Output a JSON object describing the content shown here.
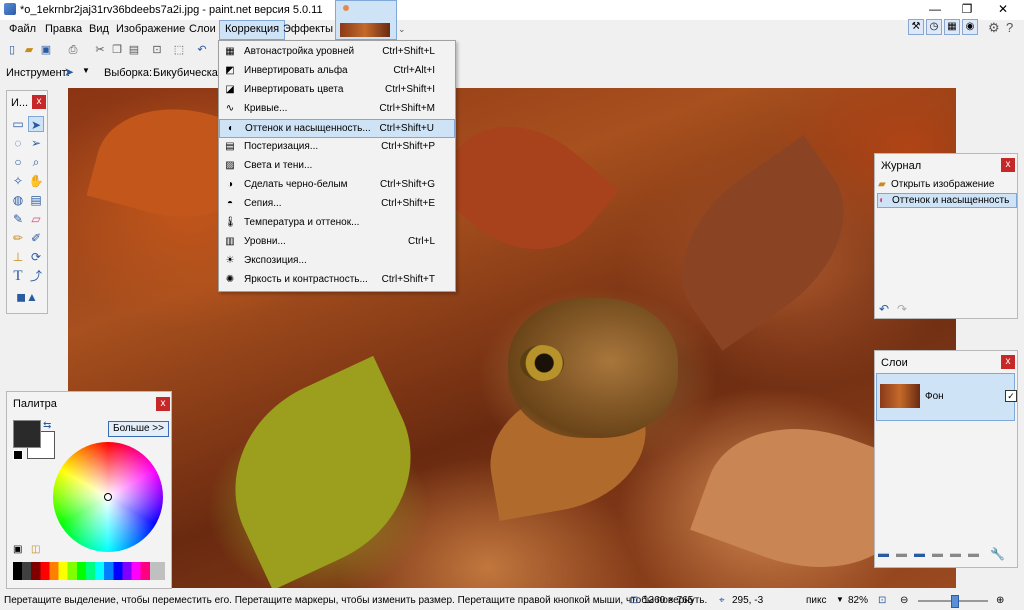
{
  "window": {
    "title": "*o_1ekrnbr2jaj31rv36bdeebs7a2i.jpg - paint.net версия 5.0.11",
    "minimize": "—",
    "maximize": "❐",
    "close": "✕"
  },
  "menubar": {
    "items": [
      "Файл",
      "Правка",
      "Вид",
      "Изображение",
      "Слои",
      "Коррекция",
      "Эффекты"
    ]
  },
  "toolbar": {
    "tool_label": "Инструмент:",
    "selection_label": "Выборка:",
    "selection_value": "Бикубическая"
  },
  "correction_menu": {
    "items": [
      {
        "label": "Автонастройка уровней",
        "shortcut": "Ctrl+Shift+L",
        "icon": "auto-levels-icon"
      },
      {
        "label": "Инвертировать альфа",
        "shortcut": "Ctrl+Alt+I",
        "icon": "invert-alpha-icon"
      },
      {
        "label": "Инвертировать цвета",
        "shortcut": "Ctrl+Shift+I",
        "icon": "invert-colors-icon"
      },
      {
        "label": "Кривые...",
        "shortcut": "Ctrl+Shift+M",
        "icon": "curves-icon"
      },
      {
        "label": "Оттенок и насыщенность...",
        "shortcut": "Ctrl+Shift+U",
        "icon": "hue-saturation-icon"
      },
      {
        "label": "Постеризация...",
        "shortcut": "Ctrl+Shift+P",
        "icon": "posterize-icon"
      },
      {
        "label": "Света и тени...",
        "shortcut": "",
        "icon": "shadows-highlights-icon"
      },
      {
        "label": "Сделать черно-белым",
        "shortcut": "Ctrl+Shift+G",
        "icon": "black-white-icon"
      },
      {
        "label": "Сепия...",
        "shortcut": "Ctrl+Shift+E",
        "icon": "sepia-icon"
      },
      {
        "label": "Температура и оттенок...",
        "shortcut": "",
        "icon": "temperature-icon"
      },
      {
        "label": "Уровни...",
        "shortcut": "Ctrl+L",
        "icon": "levels-icon"
      },
      {
        "label": "Экспозиция...",
        "shortcut": "",
        "icon": "exposure-icon"
      },
      {
        "label": "Яркость и контрастность...",
        "shortcut": "Ctrl+Shift+T",
        "icon": "brightness-contrast-icon"
      }
    ]
  },
  "tools_panel": {
    "title": "И..."
  },
  "palette": {
    "title": "Палитра",
    "more_button": "Больше >>"
  },
  "history": {
    "title": "Журнал",
    "items": [
      "Открыть изображение",
      "Оттенок и насыщенность"
    ]
  },
  "layers": {
    "title": "Слои",
    "layer_name": "Фон",
    "layer_visible": true
  },
  "status": {
    "hint": "Перетащите выделение, чтобы переместить его. Перетащите маркеры, чтобы изменить размер. Перетащите правой кнопкой мыши, чтобы повернуть.",
    "size": "1360 × 765",
    "cursor": "295, -3",
    "units": "пикс",
    "zoom": "82%"
  },
  "colors": {
    "menu_highlight": "#cfe3f7",
    "highlight_border": "#7fa8d8",
    "close_red": "#c62828",
    "primary_color": "#2a2a2a",
    "secondary_color": "#ffffff"
  }
}
